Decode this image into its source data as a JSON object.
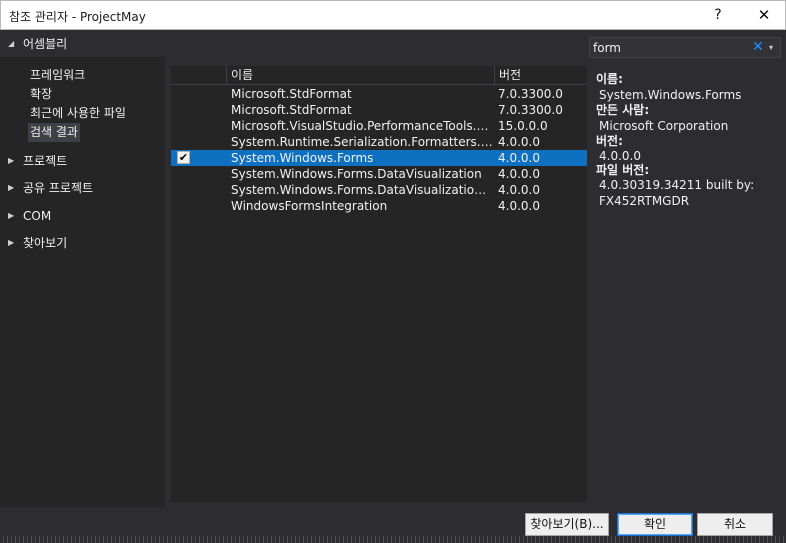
{
  "window": {
    "title": "참조 관리자 - ProjectMay",
    "help_label": "?",
    "close_label": "✕"
  },
  "sidebar": {
    "groups": [
      {
        "label": "어셈블리",
        "expanded": true,
        "items": [
          "프레임워크",
          "확장",
          "최근에 사용한 파일",
          "검색 결과"
        ],
        "selected_item": "검색 결과"
      },
      {
        "label": "프로젝트",
        "expanded": false
      },
      {
        "label": "공유 프로젝트",
        "expanded": false
      },
      {
        "label": "COM",
        "expanded": false
      },
      {
        "label": "찾아보기",
        "expanded": false
      }
    ]
  },
  "search": {
    "value": "form",
    "clear_icon": "✕",
    "dropdown_icon": "▾"
  },
  "list": {
    "columns": {
      "name": "이름",
      "version": "버전"
    },
    "rows": [
      {
        "name": "Microsoft.StdFormat",
        "version": "7.0.3300.0",
        "checked": false,
        "selected": false
      },
      {
        "name": "Microsoft.StdFormat",
        "version": "7.0.3300.0",
        "checked": false,
        "selected": false
      },
      {
        "name": "Microsoft.VisualStudio.PerformanceTools.Aut...",
        "version": "15.0.0.0",
        "checked": false,
        "selected": false
      },
      {
        "name": "System.Runtime.Serialization.Formatters.Soap",
        "version": "4.0.0.0",
        "checked": false,
        "selected": false
      },
      {
        "name": "System.Windows.Forms",
        "version": "4.0.0.0",
        "checked": true,
        "selected": true
      },
      {
        "name": "System.Windows.Forms.DataVisualization",
        "version": "4.0.0.0",
        "checked": false,
        "selected": false
      },
      {
        "name": "System.Windows.Forms.DataVisualization.Des...",
        "version": "4.0.0.0",
        "checked": false,
        "selected": false
      },
      {
        "name": "WindowsFormsIntegration",
        "version": "4.0.0.0",
        "checked": false,
        "selected": false
      }
    ],
    "check_glyph": "✔"
  },
  "details": {
    "name_label": "이름:",
    "name_value": "System.Windows.Forms",
    "author_label": "만든 사람:",
    "author_value": "Microsoft Corporation",
    "version_label": "버전:",
    "version_value": "4.0.0.0",
    "file_version_label": "파일 버전:",
    "file_version_value_1": "4.0.30319.34211 built by:",
    "file_version_value_2": "FX452RTMGDR"
  },
  "buttons": {
    "browse": "찾아보기(B)...",
    "ok": "확인",
    "cancel": "취소"
  },
  "colors": {
    "selection": "#0e70c0",
    "panel": "#252526",
    "background": "#2d2d30",
    "accent": "#1e90ff"
  }
}
